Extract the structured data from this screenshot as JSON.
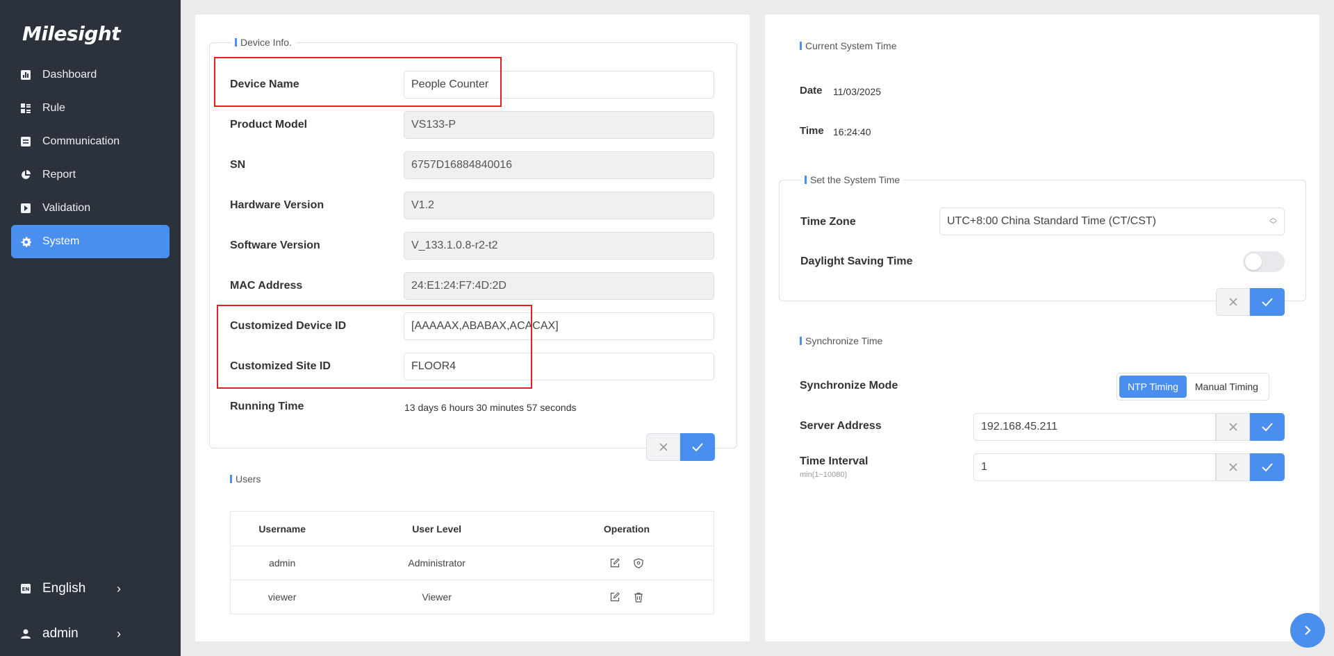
{
  "brand": {
    "logo_text": "Milesight"
  },
  "sidebar": {
    "items": [
      {
        "label": "Dashboard",
        "icon": "dashboard-icon"
      },
      {
        "label": "Rule",
        "icon": "rule-icon"
      },
      {
        "label": "Communication",
        "icon": "communication-icon"
      },
      {
        "label": "Report",
        "icon": "report-icon"
      },
      {
        "label": "Validation",
        "icon": "validation-icon"
      },
      {
        "label": "System",
        "icon": "gear-icon",
        "active": true
      }
    ],
    "language": {
      "badge": "EN",
      "label": "English"
    },
    "user": {
      "label": "admin"
    }
  },
  "device_info": {
    "title": "Device Info.",
    "device_name": {
      "label": "Device Name",
      "value": "People Counter"
    },
    "product_model": {
      "label": "Product Model",
      "value": "VS133-P"
    },
    "sn": {
      "label": "SN",
      "value": "6757D16884840016"
    },
    "hardware_version": {
      "label": "Hardware Version",
      "value": "V1.2"
    },
    "software_version": {
      "label": "Software Version",
      "value": "V_133.1.0.8-r2-t2"
    },
    "mac_address": {
      "label": "MAC Address",
      "value": "24:E1:24:F7:4D:2D"
    },
    "customized_device_id": {
      "label": "Customized Device ID",
      "value": "[AAAAAX,ABABAX,ACACAX]"
    },
    "customized_site_id": {
      "label": "Customized Site ID",
      "value": "FLOOR4"
    },
    "running_time": {
      "label": "Running Time",
      "value": "13 days 6 hours 30 minutes 57 seconds"
    }
  },
  "users": {
    "title": "Users",
    "columns": [
      "Username",
      "User Level",
      "Operation"
    ],
    "rows": [
      {
        "username": "admin",
        "level": "Administrator",
        "ops": [
          "edit-icon",
          "shield-icon"
        ]
      },
      {
        "username": "viewer",
        "level": "Viewer",
        "ops": [
          "edit-icon",
          "trash-icon"
        ]
      }
    ]
  },
  "current_time": {
    "title": "Current System Time",
    "date": {
      "label": "Date",
      "value": "11/03/2025"
    },
    "time": {
      "label": "Time",
      "value": "16:24:40"
    }
  },
  "set_time": {
    "title": "Set the System Time",
    "time_zone": {
      "label": "Time Zone",
      "value": "UTC+8:00 China Standard Time (CT/CST)"
    },
    "dst": {
      "label": "Daylight Saving Time",
      "enabled": false
    }
  },
  "sync_time": {
    "title": "Synchronize Time",
    "mode": {
      "label": "Synchronize Mode",
      "options": [
        "NTP Timing",
        "Manual Timing"
      ],
      "selected": "NTP Timing"
    },
    "server_address": {
      "label": "Server Address",
      "value": "192.168.45.211"
    },
    "time_interval": {
      "label": "Time Interval",
      "hint": "min(1~10080)",
      "value": "1"
    }
  },
  "colors": {
    "accent": "#4a8ff0",
    "sidebar_bg": "#2c323b",
    "highlight": "#e02020"
  }
}
